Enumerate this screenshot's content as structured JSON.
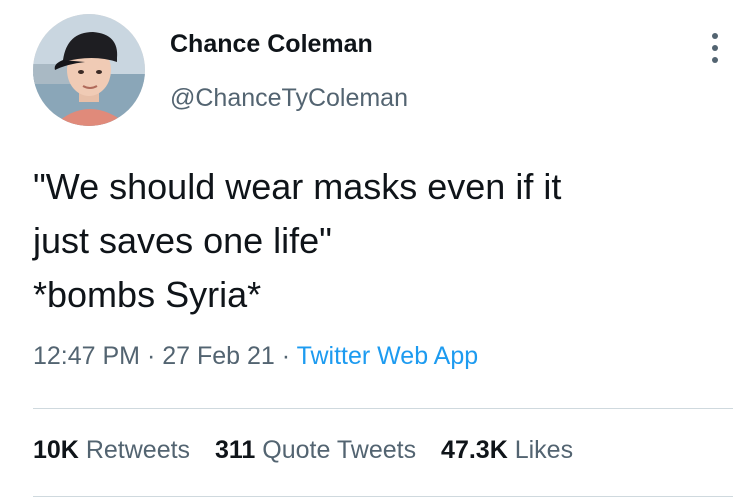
{
  "author": {
    "name": "Chance Coleman",
    "handle": "@ChanceTyColeman"
  },
  "icons": {
    "more": "more-vertical-icon",
    "avatar": "profile-photo"
  },
  "tweet": {
    "lines": [
      "\"We should wear masks even if it",
      "just saves one life\"",
      "*bombs Syria*"
    ]
  },
  "meta": {
    "time": "12:47 PM",
    "separator1": " · ",
    "date": "27 Feb 21",
    "separator2": " · ",
    "app": "Twitter Web App"
  },
  "stats": {
    "retweets_count": "10K",
    "retweets_label": "Retweets",
    "quotes_count": "311",
    "quotes_label": "Quote Tweets",
    "likes_count": "47.3K",
    "likes_label": "Likes"
  },
  "colors": {
    "text_primary": "#0f1419",
    "text_secondary": "#536471",
    "link": "#1d9bf0",
    "divider": "#cfd9de"
  }
}
